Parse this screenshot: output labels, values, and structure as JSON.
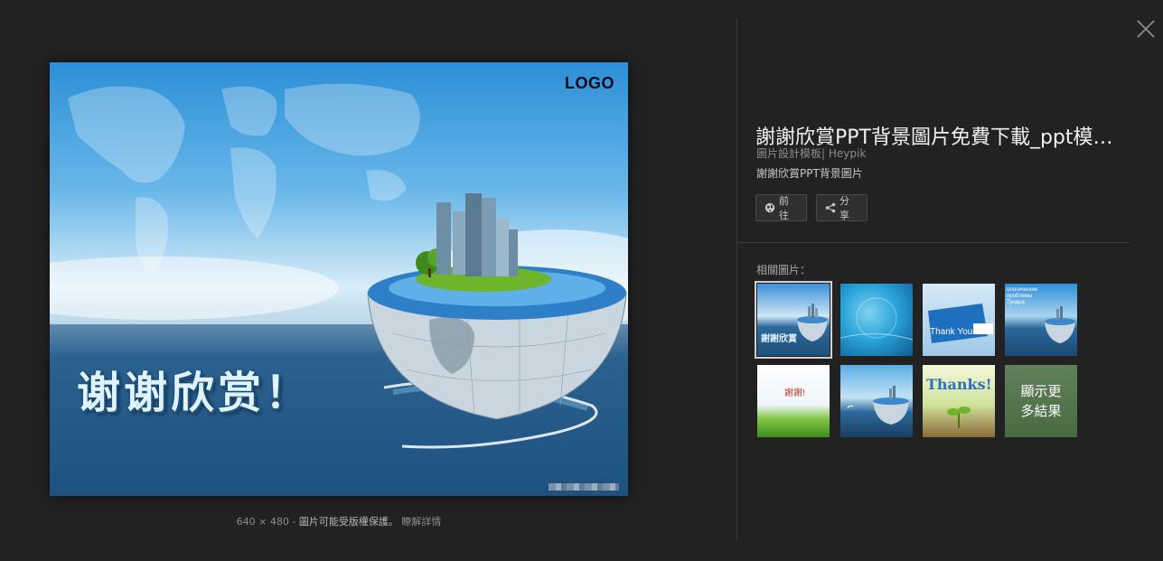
{
  "preview": {
    "logo_text": "LOGO",
    "headline": "谢谢欣赏！",
    "watermark": "pik"
  },
  "caption": {
    "dimensions": "640 × 480",
    "separator": "-",
    "copyright_notice": "圖片可能受版權保護。",
    "learn_more": "瞭解詳情"
  },
  "panel": {
    "title": "謝謝欣賞PPT背景圖片免費下載_ppt模板-Heypik",
    "source": "圖片設計模板| Heypik",
    "subtitle": "謝謝欣賞PPT背景圖片",
    "visit_label": "前往",
    "share_label": "分享",
    "related_label": "相關圖片："
  },
  "related": [
    {
      "caption": "謝謝欣賞",
      "selected": true
    },
    {
      "caption": "",
      "selected": false
    },
    {
      "caption": "Thank You!",
      "selected": false
    },
    {
      "caption": "ологические проблемы Тунара",
      "selected": false
    },
    {
      "caption": "謝謝!",
      "selected": false
    },
    {
      "caption": "",
      "selected": false
    },
    {
      "caption": "Thanks!",
      "selected": false
    },
    {
      "caption": "顯示更多結果",
      "selected": false
    }
  ],
  "colors": {
    "background": "#222222",
    "title": "#f0f0f0",
    "muted": "#8c8c8c"
  },
  "icons": [
    "close-icon",
    "globe-icon",
    "share-icon"
  ]
}
